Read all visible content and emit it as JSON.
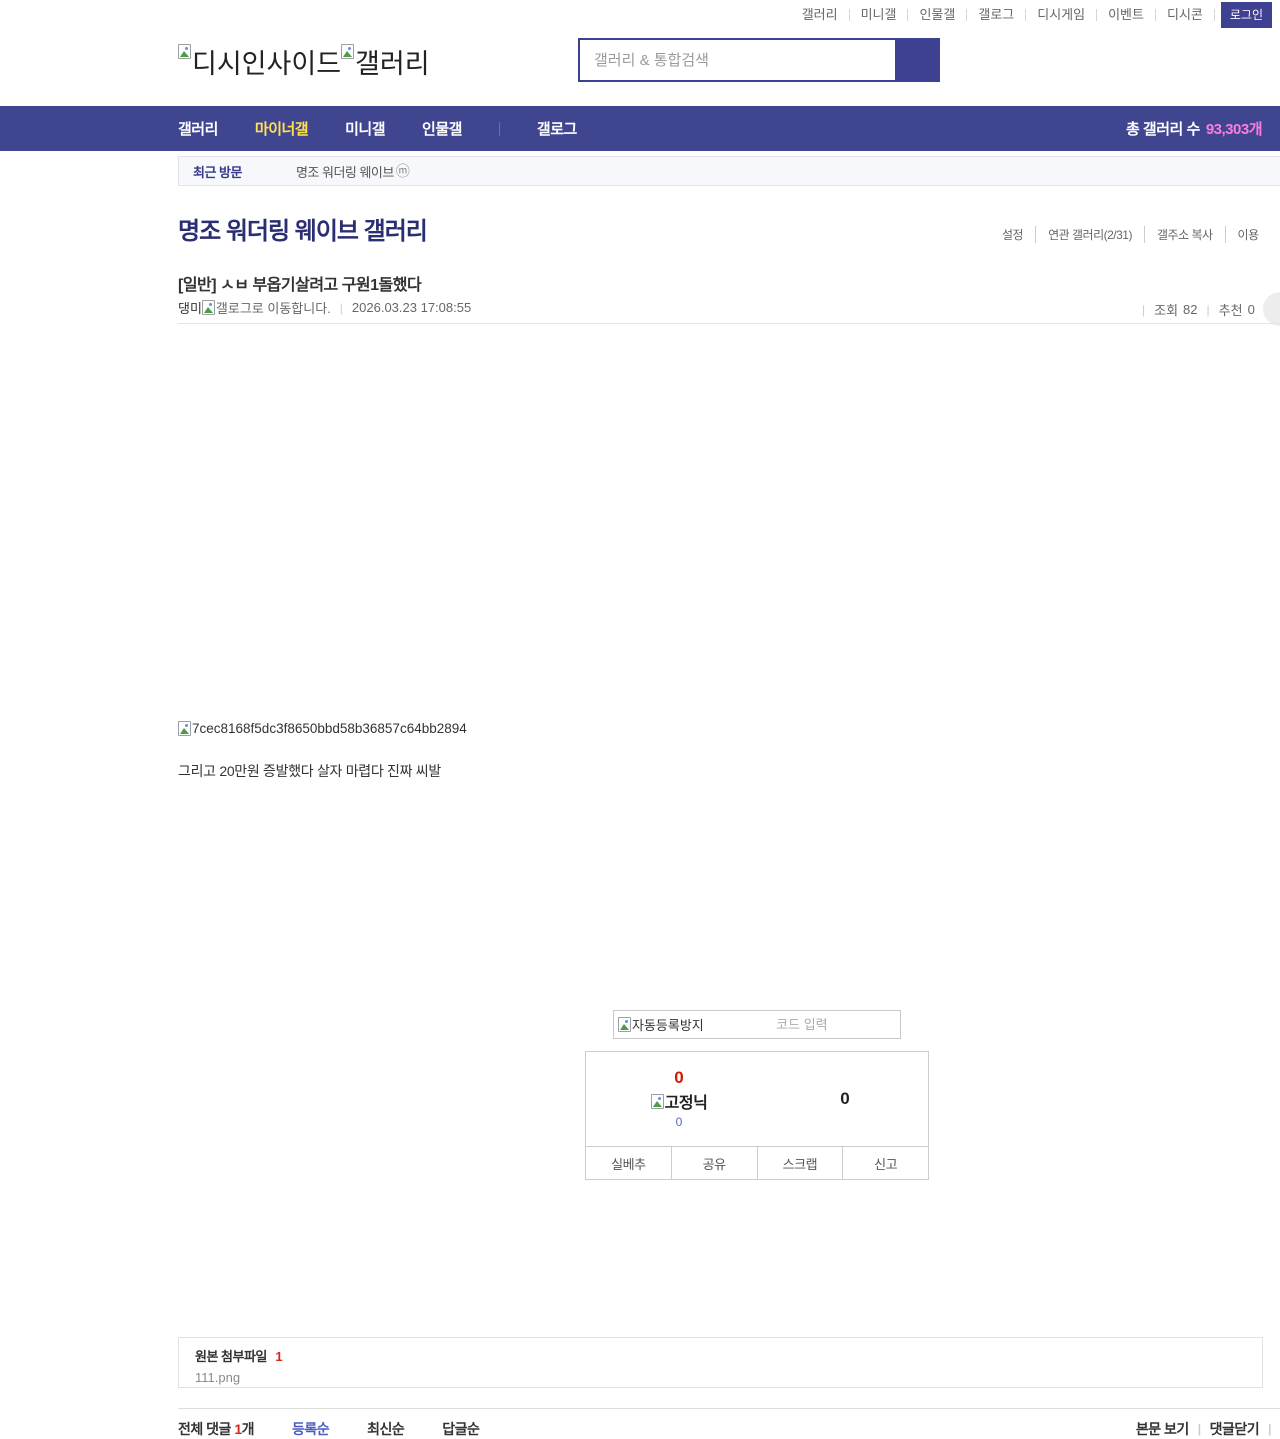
{
  "topbar": {
    "links": [
      "갤러리",
      "미니갤",
      "인물갤",
      "갤로그",
      "디시게임",
      "이벤트",
      "디시콘"
    ],
    "login_label": "로그인"
  },
  "header": {
    "logo_part1": "디시인사이드",
    "logo_part2": "갤러리",
    "search_placeholder": "갤러리 & 통합검색"
  },
  "nav": {
    "items": [
      {
        "label": "갤러리"
      },
      {
        "label": "마이너갤"
      },
      {
        "label": "미니갤"
      },
      {
        "label": "인물갤"
      },
      {
        "label": "갤로그"
      }
    ],
    "total_label": "총 갤러리 수",
    "total_count": "93,303개"
  },
  "breadcrumb": {
    "recent_label": "최근 방문",
    "gallery_name": "명조 워더링 웨이브",
    "minor_badge": "ⓜ"
  },
  "gallery": {
    "title": "명조 워더링 웨이브 갤러리",
    "menu": [
      "설정",
      "연관 갤러리(2/31)",
      "갤주소 복사",
      "이용"
    ]
  },
  "post": {
    "category": "[일반]",
    "title": "ㅅㅂ 부옵기살려고 구원1돌했다",
    "author": "댕미",
    "gallog_text": "갤로그로 이동합니다.",
    "date": "2026.03.23 17:08:55",
    "views_label": "조회",
    "views": "82",
    "rec_label": "추천",
    "rec": "0",
    "image_alt": "7cec8168f5dc3f8650bbd58b36857c64bb2894",
    "body_text": "그리고 20만원 증발했다 살자 마렵다 진짜 씨발"
  },
  "captcha": {
    "image_alt": "자동등록방지",
    "input_placeholder": "코드 입력"
  },
  "vote": {
    "up_count": "0",
    "fixed_label": "고정닉",
    "fixed_count": "0",
    "down_count": "0",
    "buttons": [
      "실베추",
      "공유",
      "스크랩",
      "신고"
    ]
  },
  "attachment": {
    "label": "원본 첨부파일",
    "count": "1",
    "filename": "111.png"
  },
  "comments": {
    "total_label": "전체 댓글 ",
    "count": "1",
    "count_suffix": "개",
    "sorts": [
      "등록순",
      "최신순",
      "답글순"
    ],
    "view_post": "본문 보기",
    "close_comments": "댓글닫기"
  },
  "colors": {
    "navy": "#404590",
    "active_yellow": "#ffe24c",
    "count_pink": "#f97edd",
    "title_navy": "#2b2e72",
    "red": "#d31900",
    "sort_blue": "#4a5cc0"
  }
}
